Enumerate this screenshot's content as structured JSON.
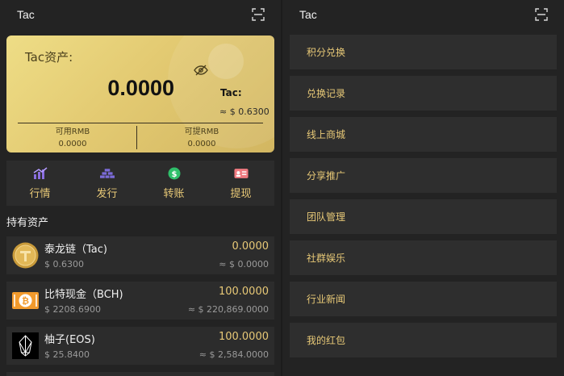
{
  "left": {
    "topbar": {
      "title": "Tac",
      "scan_icon": "scan-icon"
    },
    "asset_card": {
      "label": "Tac资产:",
      "amount": "0.0000",
      "unit": "Tac:",
      "approx_value": "≈ $ 0.6300",
      "available_label": "可用RMB",
      "available_value": "0.0000",
      "withdrawable_label": "可提RMB",
      "withdrawable_value": "0.0000"
    },
    "actions": [
      {
        "label": "行情",
        "icon": "chart-icon"
      },
      {
        "label": "发行",
        "icon": "stack-icon"
      },
      {
        "label": "转账",
        "icon": "coin-icon"
      },
      {
        "label": "提现",
        "icon": "card-icon"
      }
    ],
    "holdings_title": "持有资产",
    "holdings": [
      {
        "name": "泰龙链（Tac)",
        "price": "$ 0.6300",
        "balance": "0.0000",
        "value": "≈ $ 0.0000",
        "icon": "tac-coin-icon"
      },
      {
        "name": "比特现金（BCH)",
        "price": "$ 2208.6900",
        "balance": "100.0000",
        "value": "≈ $ 220,869.0000",
        "icon": "bitcoin-cash-icon"
      },
      {
        "name": "柚子(EOS)",
        "price": "$ 25.8400",
        "balance": "100.0000",
        "value": "≈ $ 2,584.0000",
        "icon": "eos-icon"
      }
    ]
  },
  "right": {
    "topbar": {
      "title": "Tac",
      "scan_icon": "scan-icon"
    },
    "menu": [
      "积分兑换",
      "兑换记录",
      "线上商城",
      "分享推广",
      "团队管理",
      "社群娱乐",
      "行业新闻",
      "我的红包"
    ]
  },
  "colors": {
    "accent": "#e8c977",
    "card_gold": "#e3ca72",
    "panel": "#232323",
    "item": "#2c2c2c"
  }
}
